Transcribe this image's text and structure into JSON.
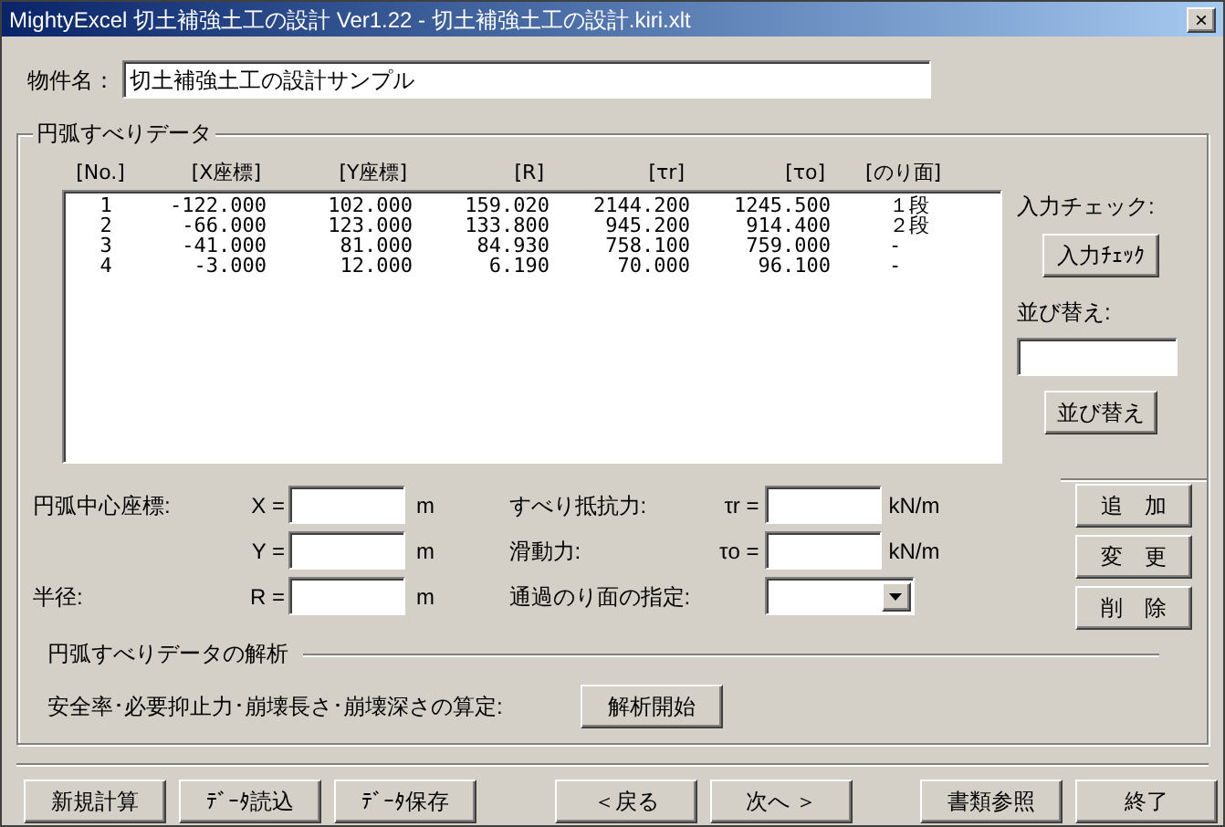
{
  "window": {
    "title": "MightyExcel 切土補強土工の設計 Ver1.22 - 切土補強土工の設計.kiri.xlt",
    "close": "×"
  },
  "property": {
    "label": "物件名：",
    "value": "切土補強土工の設計サンプル"
  },
  "group": {
    "title": "円弧すべりデータ",
    "columns": [
      "[No.]",
      "[X座標]",
      "[Y座標]",
      "[R]",
      "[τr]",
      "[τo]",
      "[のり面]"
    ],
    "rows": [
      {
        "cells": [
          "1",
          "-122.000",
          "102.000",
          "159.020",
          "2144.200",
          "1245.500",
          "１段"
        ],
        "selected": false
      },
      {
        "cells": [
          "2",
          "-66.000",
          "123.000",
          "133.800",
          "945.200",
          "914.400",
          "２段"
        ],
        "selected": false
      },
      {
        "cells": [
          "3",
          "-41.000",
          "81.000",
          "84.930",
          "758.100",
          "759.000",
          "-"
        ],
        "selected": false
      },
      {
        "cells": [
          "4",
          "-3.000",
          "12.000",
          "6.190",
          "70.000",
          "96.100",
          "-"
        ],
        "selected": false
      }
    ],
    "input_check": {
      "label": "入力チェック:",
      "button": "入力ﾁｪｯｸ"
    },
    "sort": {
      "label": "並び替え:",
      "button": "並び替え"
    },
    "center_label": "円弧中心座標:",
    "radius_label": "半径:",
    "x": {
      "label": "X =",
      "unit": "m"
    },
    "y": {
      "label": "Y =",
      "unit": "m"
    },
    "r": {
      "label": "R =",
      "unit": "m"
    },
    "resist": {
      "label": "すべり抵抗力:",
      "symbol": "τr =",
      "unit": "kN/m"
    },
    "slide": {
      "label": "滑動力:",
      "symbol": "τo =",
      "unit": "kN/m"
    },
    "slope": {
      "label": "通過のり面の指定:"
    },
    "side_buttons": [
      "追　加",
      "変　更",
      "削　除"
    ],
    "analysis": {
      "title": "円弧すべりデータの解析",
      "label": "安全率･必要抑止力･崩壊長さ･崩壊深さの算定:",
      "button": "解析開始"
    }
  },
  "footer": {
    "left": [
      "新規計算",
      "ﾃﾞｰﾀ読込",
      "ﾃﾞｰﾀ保存"
    ],
    "middle": [
      "＜戻る",
      "次へ ＞"
    ],
    "right": [
      "書類参照",
      "終了"
    ]
  }
}
